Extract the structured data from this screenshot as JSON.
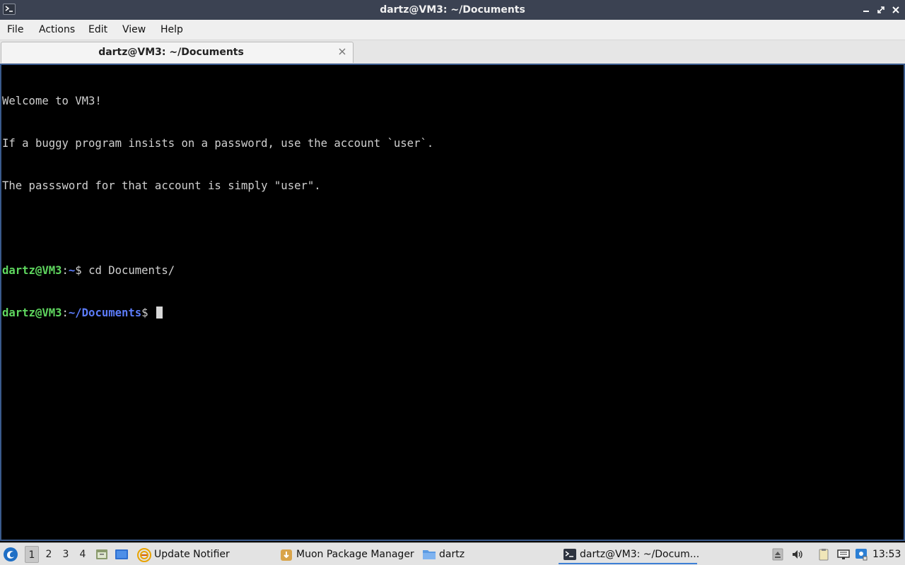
{
  "window": {
    "title": "dartz@VM3: ~/Documents",
    "icons": {
      "app": "terminal-icon",
      "minimize": "minimize-icon",
      "maximize": "maximize-icon",
      "close": "close-icon"
    }
  },
  "menu": {
    "file": "File",
    "actions": "Actions",
    "edit": "Edit",
    "view": "View",
    "help": "Help"
  },
  "tab": {
    "label": "dartz@VM3: ~/Documents",
    "close_icon": "close-icon"
  },
  "terminal": {
    "motd": [
      "Welcome to VM3!",
      "If a buggy program insists on a password, use the account `user`.",
      "The passsword for that account is simply \"user\"."
    ],
    "history": [
      {
        "user_host": "dartz@VM3",
        "sep": ":",
        "path": "~",
        "prompt": "$ ",
        "command": "cd Documents/"
      },
      {
        "user_host": "dartz@VM3",
        "sep": ":",
        "path": "~/Documents",
        "prompt": "$ ",
        "command": ""
      }
    ],
    "colors": {
      "user_host": "#5fd75f",
      "path": "#5c7cfa",
      "text": "#d0d0d0",
      "background": "#000000"
    }
  },
  "taskbar": {
    "start_icon": "start-menu-icon",
    "workspaces": [
      "1",
      "2",
      "3",
      "4"
    ],
    "active_workspace": "1",
    "quicklaunch": [
      "file-manager-icon",
      "show-desktop-icon"
    ],
    "tasks": [
      {
        "label": "Update Notifier",
        "icon": "update-notifier-icon"
      },
      {
        "label": "Muon Package Manager",
        "icon": "package-manager-icon"
      },
      {
        "label": "dartz",
        "icon": "folder-icon"
      },
      {
        "label": "dartz@VM3: ~/Docum...",
        "icon": "terminal-icon"
      }
    ],
    "tray": [
      "eject-icon",
      "volume-icon",
      "clipboard-icon",
      "network-icon",
      "update-tray-icon"
    ],
    "clock": "13:53",
    "accent": "#3d7fd6"
  }
}
